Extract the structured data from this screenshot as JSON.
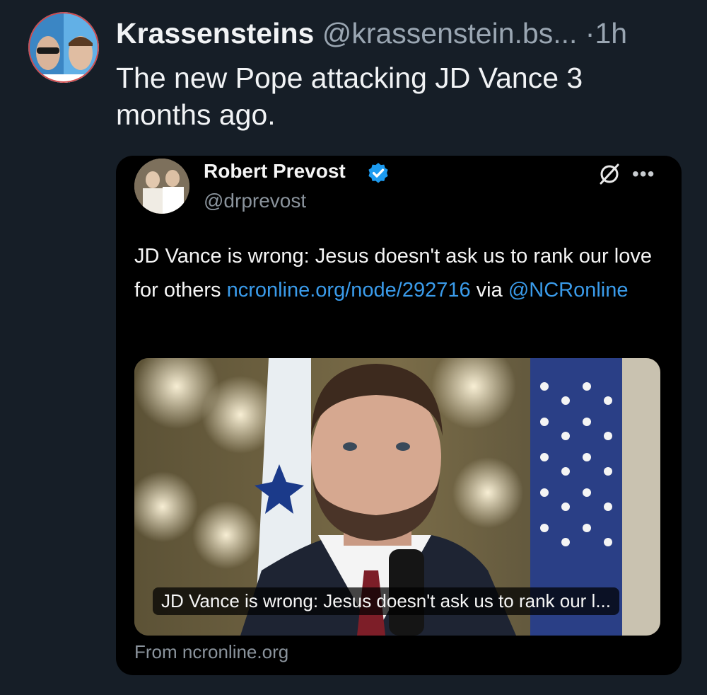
{
  "post": {
    "author_name": "Krassensteins",
    "author_handle": "@krassenstein.bs...",
    "time": "1h",
    "separator": "·",
    "text": "The new Pope attacking JD Vance 3 months ago."
  },
  "embed": {
    "name": "Robert Prevost",
    "handle": "@drprevost",
    "verified": true,
    "text_prefix": "JD Vance is wrong: Jesus doesn't ask us to rank our love for others ",
    "link": "ncronline.org/node/292716",
    "text_via": " via ",
    "mention": "@NCRonline",
    "more_label": "•••",
    "media_caption": "JD Vance is wrong: Jesus doesn't ask us to rank our l...",
    "source": "From ncronline.org"
  },
  "icons": {
    "verified": "verified-badge-icon",
    "grok": "grok-icon",
    "more": "more-options-icon"
  },
  "colors": {
    "background": "#161e27",
    "link": "#3a9bea",
    "verified": "#1d9bf0"
  }
}
